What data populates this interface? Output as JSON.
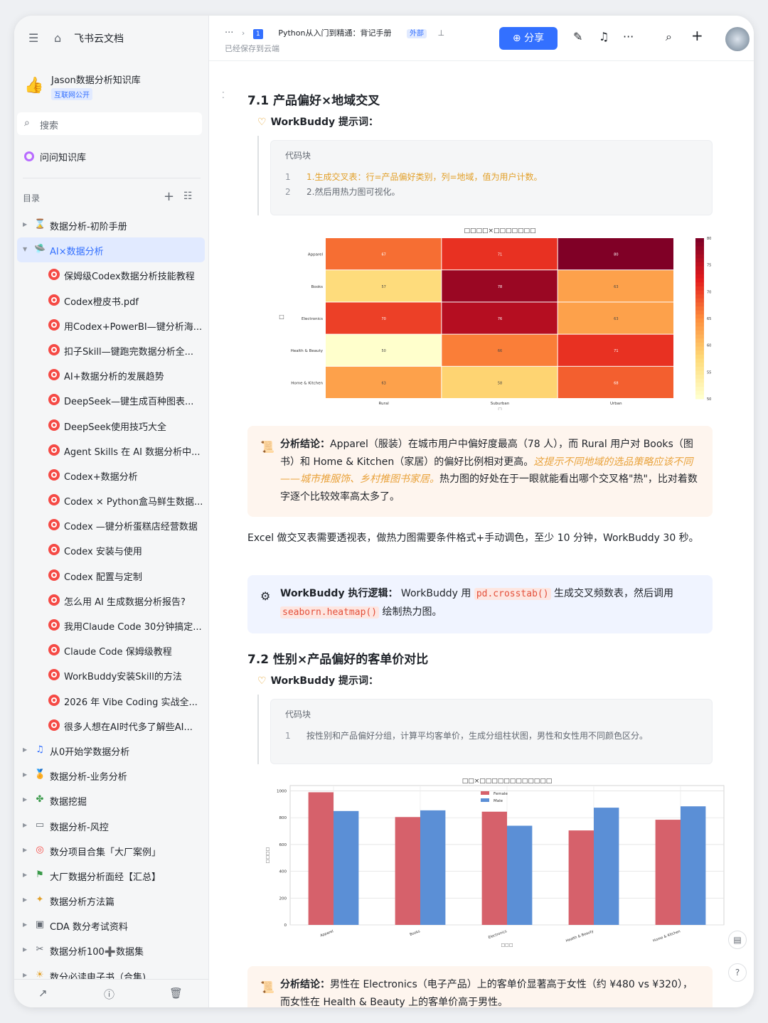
{
  "sidebar": {
    "brand": "飞书云文档",
    "kb_name": "Jason数据分析知识库",
    "kb_tag": "互联网公开",
    "search_placeholder": "搜索",
    "ask_label": "问问知识库",
    "toc_label": "目录",
    "items": [
      {
        "label": "数据分析-初阶手册",
        "level": "top",
        "icon": "hourglass"
      },
      {
        "label": "AI×数据分析",
        "level": "top",
        "icon": "ufo",
        "active": true,
        "expanded": true
      },
      {
        "label": "保姆级Codex数据分析技能教程",
        "level": "child"
      },
      {
        "label": "Codex橙皮书.pdf",
        "level": "child"
      },
      {
        "label": "用Codex+PowerBI—键分析海...",
        "level": "child"
      },
      {
        "label": "扣子Skill—键跑完数据分析全...",
        "level": "child"
      },
      {
        "label": "AI+数据分析的发展趋势",
        "level": "child"
      },
      {
        "label": "DeepSeek—键生成百种图表...",
        "level": "child"
      },
      {
        "label": "DeepSeek使用技巧大全",
        "level": "child"
      },
      {
        "label": "Agent Skills 在 AI 数据分析中...",
        "level": "child"
      },
      {
        "label": "Codex+数据分析",
        "level": "child"
      },
      {
        "label": "Codex × Python盒马鲜生数据...",
        "level": "child"
      },
      {
        "label": "Codex —键分析蛋糕店经营数据",
        "level": "child"
      },
      {
        "label": "Codex 安装与使用",
        "level": "child"
      },
      {
        "label": "Codex 配置与定制",
        "level": "child"
      },
      {
        "label": "怎么用 AI 生成数据分析报告?",
        "level": "child"
      },
      {
        "label": "我用Claude Code 30分钟搞定...",
        "level": "child"
      },
      {
        "label": "Claude Code 保姆级教程",
        "level": "child"
      },
      {
        "label": "WorkBuddy安装Skill的方法",
        "level": "child"
      },
      {
        "label": "2026 年 Vibe Coding 实战全...",
        "level": "child"
      },
      {
        "label": "很多人想在AI时代多了解些AI...",
        "level": "child"
      },
      {
        "label": "从0开始学数据分析",
        "level": "top",
        "icon": "music"
      },
      {
        "label": "数据分析-业务分析",
        "level": "top",
        "icon": "medal"
      },
      {
        "label": "数据挖掘",
        "level": "top",
        "icon": "clover"
      },
      {
        "label": "数据分析-风控",
        "level": "top",
        "icon": "chat"
      },
      {
        "label": "数分项目合集「大厂案例」",
        "level": "top",
        "icon": "target"
      },
      {
        "label": "大厂数据分析面经【汇总】",
        "level": "top",
        "icon": "flag"
      },
      {
        "label": "数据分析方法篇",
        "level": "top",
        "icon": "sparkle"
      },
      {
        "label": "CDA 数分考试资料",
        "level": "top",
        "icon": "frame"
      },
      {
        "label": "数据分析100➕数据集",
        "level": "top",
        "icon": "tools"
      },
      {
        "label": "数分必读电子书（合集)",
        "level": "top",
        "icon": "sun"
      }
    ]
  },
  "header": {
    "crumb_dots": "···",
    "doc_badge": "1",
    "doc_title": "Python从入门到精通：背记手册",
    "external_tag": "外部",
    "saved_status": "已经保存到云端",
    "share_label": "分享"
  },
  "section1": {
    "title": "7.1 产品偏好×地域交叉",
    "prompt_label": "WorkBuddy 提示词：",
    "code_title": "代码块",
    "code_lines": [
      {
        "n": "1",
        "text": "1.生成交叉表：行=产品偏好类别，列=地域，值为用户计数。"
      },
      {
        "n": "2",
        "text": "2.然后用热力图可视化。"
      }
    ],
    "conclusion_label": "分析结论：",
    "conclusion_a": "Apparel（服装）在城市用户中偏好度最高（78 人），而 Rural 用户对 Books（图书）和 Home & Kitchen（家居）的偏好比例相对更高。",
    "conclusion_em": "这提示不同地域的选品策略应该不同——城市推服饰、乡村推图书家居。",
    "conclusion_b": "热力图的好处在于一眼就能看出哪个交叉格\"热\"，比对着数字逐个比较效率高太多了。",
    "para": "Excel 做交叉表需要透视表，做热力图需要条件格式+手动调色，至少 10 分钟，WorkBuddy 30 秒。",
    "logic_label": "WorkBuddy 执行逻辑：",
    "logic_a": "WorkBuddy 用",
    "logic_code1": "pd.crosstab()",
    "logic_b": "生成交叉频数表，然后调用",
    "logic_code2": "seaborn.heatmap()",
    "logic_c": "绘制热力图。"
  },
  "section2": {
    "title": "7.2 性别×产品偏好的客单价对比",
    "prompt_label": "WorkBuddy 提示词：",
    "code_title": "代码块",
    "code_lines": [
      {
        "n": "1",
        "text": "按性别和产品偏好分组，计算平均客单价，生成分组柱状图，男性和女性用不同颜色区分。"
      }
    ],
    "conclusion_label": "分析结论：",
    "conclusion_text": "男性在 Electronics（电子产品）上的客单价显著高于女性（约 ¥480 vs ¥320），而女性在 Health & Beauty 上的客单价高于男性。"
  },
  "chart_data": [
    {
      "type": "heatmap",
      "title": "□□□□×□□□□□□□",
      "xlabel": "□",
      "ylabel": "□",
      "x": [
        "Rural",
        "Suburban",
        "Urban"
      ],
      "y": [
        "Apparel",
        "Books",
        "Electronics",
        "Health & Beauty",
        "Home & Kitchen"
      ],
      "values": [
        [
          67,
          71,
          80
        ],
        [
          57,
          78,
          63
        ],
        [
          70,
          76,
          63
        ],
        [
          50,
          66,
          71
        ],
        [
          63,
          58,
          68
        ]
      ],
      "colorbar_ticks": [
        50,
        55,
        60,
        65,
        70,
        75,
        80
      ],
      "vmin": 50,
      "vmax": 80,
      "colormap": "YlOrRd"
    },
    {
      "type": "bar",
      "title": "□□×□□□□□□□□□□□□",
      "xlabel": "□□□",
      "ylabel": "□□□□",
      "categories": [
        "Apparel",
        "Books",
        "Electronics",
        "Health & Beauty",
        "Home & Kitchen"
      ],
      "series": [
        {
          "name": "Female",
          "color": "#d6616b",
          "values": [
            990,
            805,
            845,
            705,
            785
          ]
        },
        {
          "name": "Male",
          "color": "#5b8fd6",
          "values": [
            850,
            855,
            740,
            875,
            885
          ]
        }
      ],
      "yticks": [
        0,
        200,
        400,
        600,
        800,
        1000
      ],
      "ylim": [
        0,
        1040
      ],
      "grid": true,
      "legend": "top-left"
    }
  ]
}
